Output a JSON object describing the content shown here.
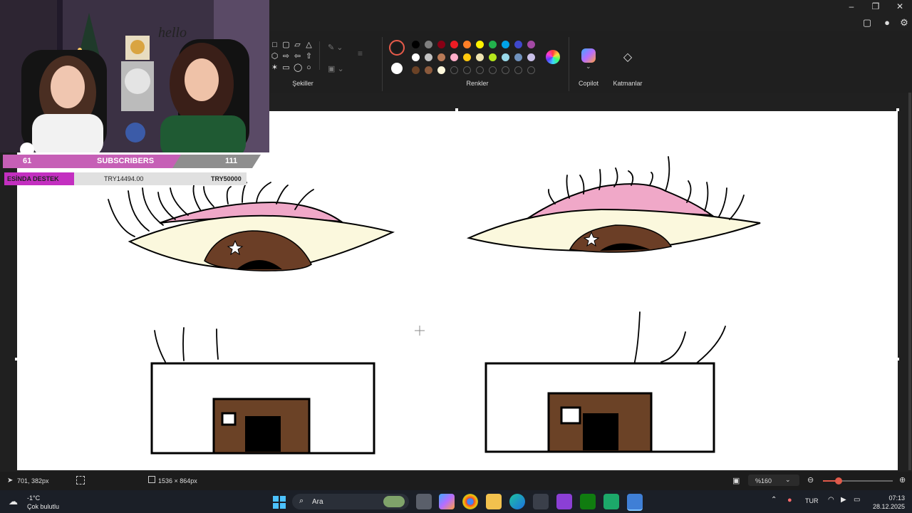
{
  "window": {
    "minimize_icon": "minimize-icon",
    "maximize_icon": "restore-icon",
    "close_icon": "close-icon"
  },
  "ribbon": {
    "groups": {
      "shapes_label": "Şekiller",
      "colors_label": "Renkler",
      "copilot_label": "Copilot",
      "layers_label": "Katmanlar"
    },
    "shapes": [
      "rectangle-icon",
      "rounded-rectangle-icon",
      "polygon-icon",
      "triangle-icon",
      "hexagon-icon",
      "arrow-right-icon",
      "arrow-left-icon",
      "arrow-up-icon",
      "star-icon",
      "speech-rect-icon",
      "speech-oval-icon",
      "speech-cloud-icon"
    ],
    "colors_row1": [
      "#000000",
      "#7f7f7f",
      "#880015",
      "#ed1c24",
      "#ff7f27",
      "#fff200",
      "#22b14c",
      "#00a2e8",
      "#3f48cc",
      "#a349a4"
    ],
    "colors_row2": [
      "#ffffff",
      "#c3c3c3",
      "#b97a57",
      "#ffaec9",
      "#ffc90e",
      "#efe4b0",
      "#b5e61d",
      "#99d9ea",
      "#7092be",
      "#c8bfe7"
    ],
    "colors_row3": [
      "#6b4226",
      "#8b5a3c",
      "#fff8dc"
    ],
    "color1": "#1a1a1a",
    "color2": "#ffffff"
  },
  "overlay": {
    "subscribers_left": "61",
    "subscribers_label": "SUBSCRIBERS",
    "subscribers_right": "111",
    "destek_label": "ESİNDA DESTEK",
    "destek_current": "TRY14494.00",
    "destek_goal": "TRY50000",
    "sign_text": "hello"
  },
  "statusbar": {
    "cursor_pos": "701, 382px",
    "canvas_size": "1536 × 864px",
    "zoom": "%160"
  },
  "taskbar": {
    "weather_temp": "-1°C",
    "weather_desc": "Çok bulutlu",
    "search_placeholder": "Ara",
    "language": "TUR",
    "time": "07:13",
    "date": "28.12.2025"
  }
}
